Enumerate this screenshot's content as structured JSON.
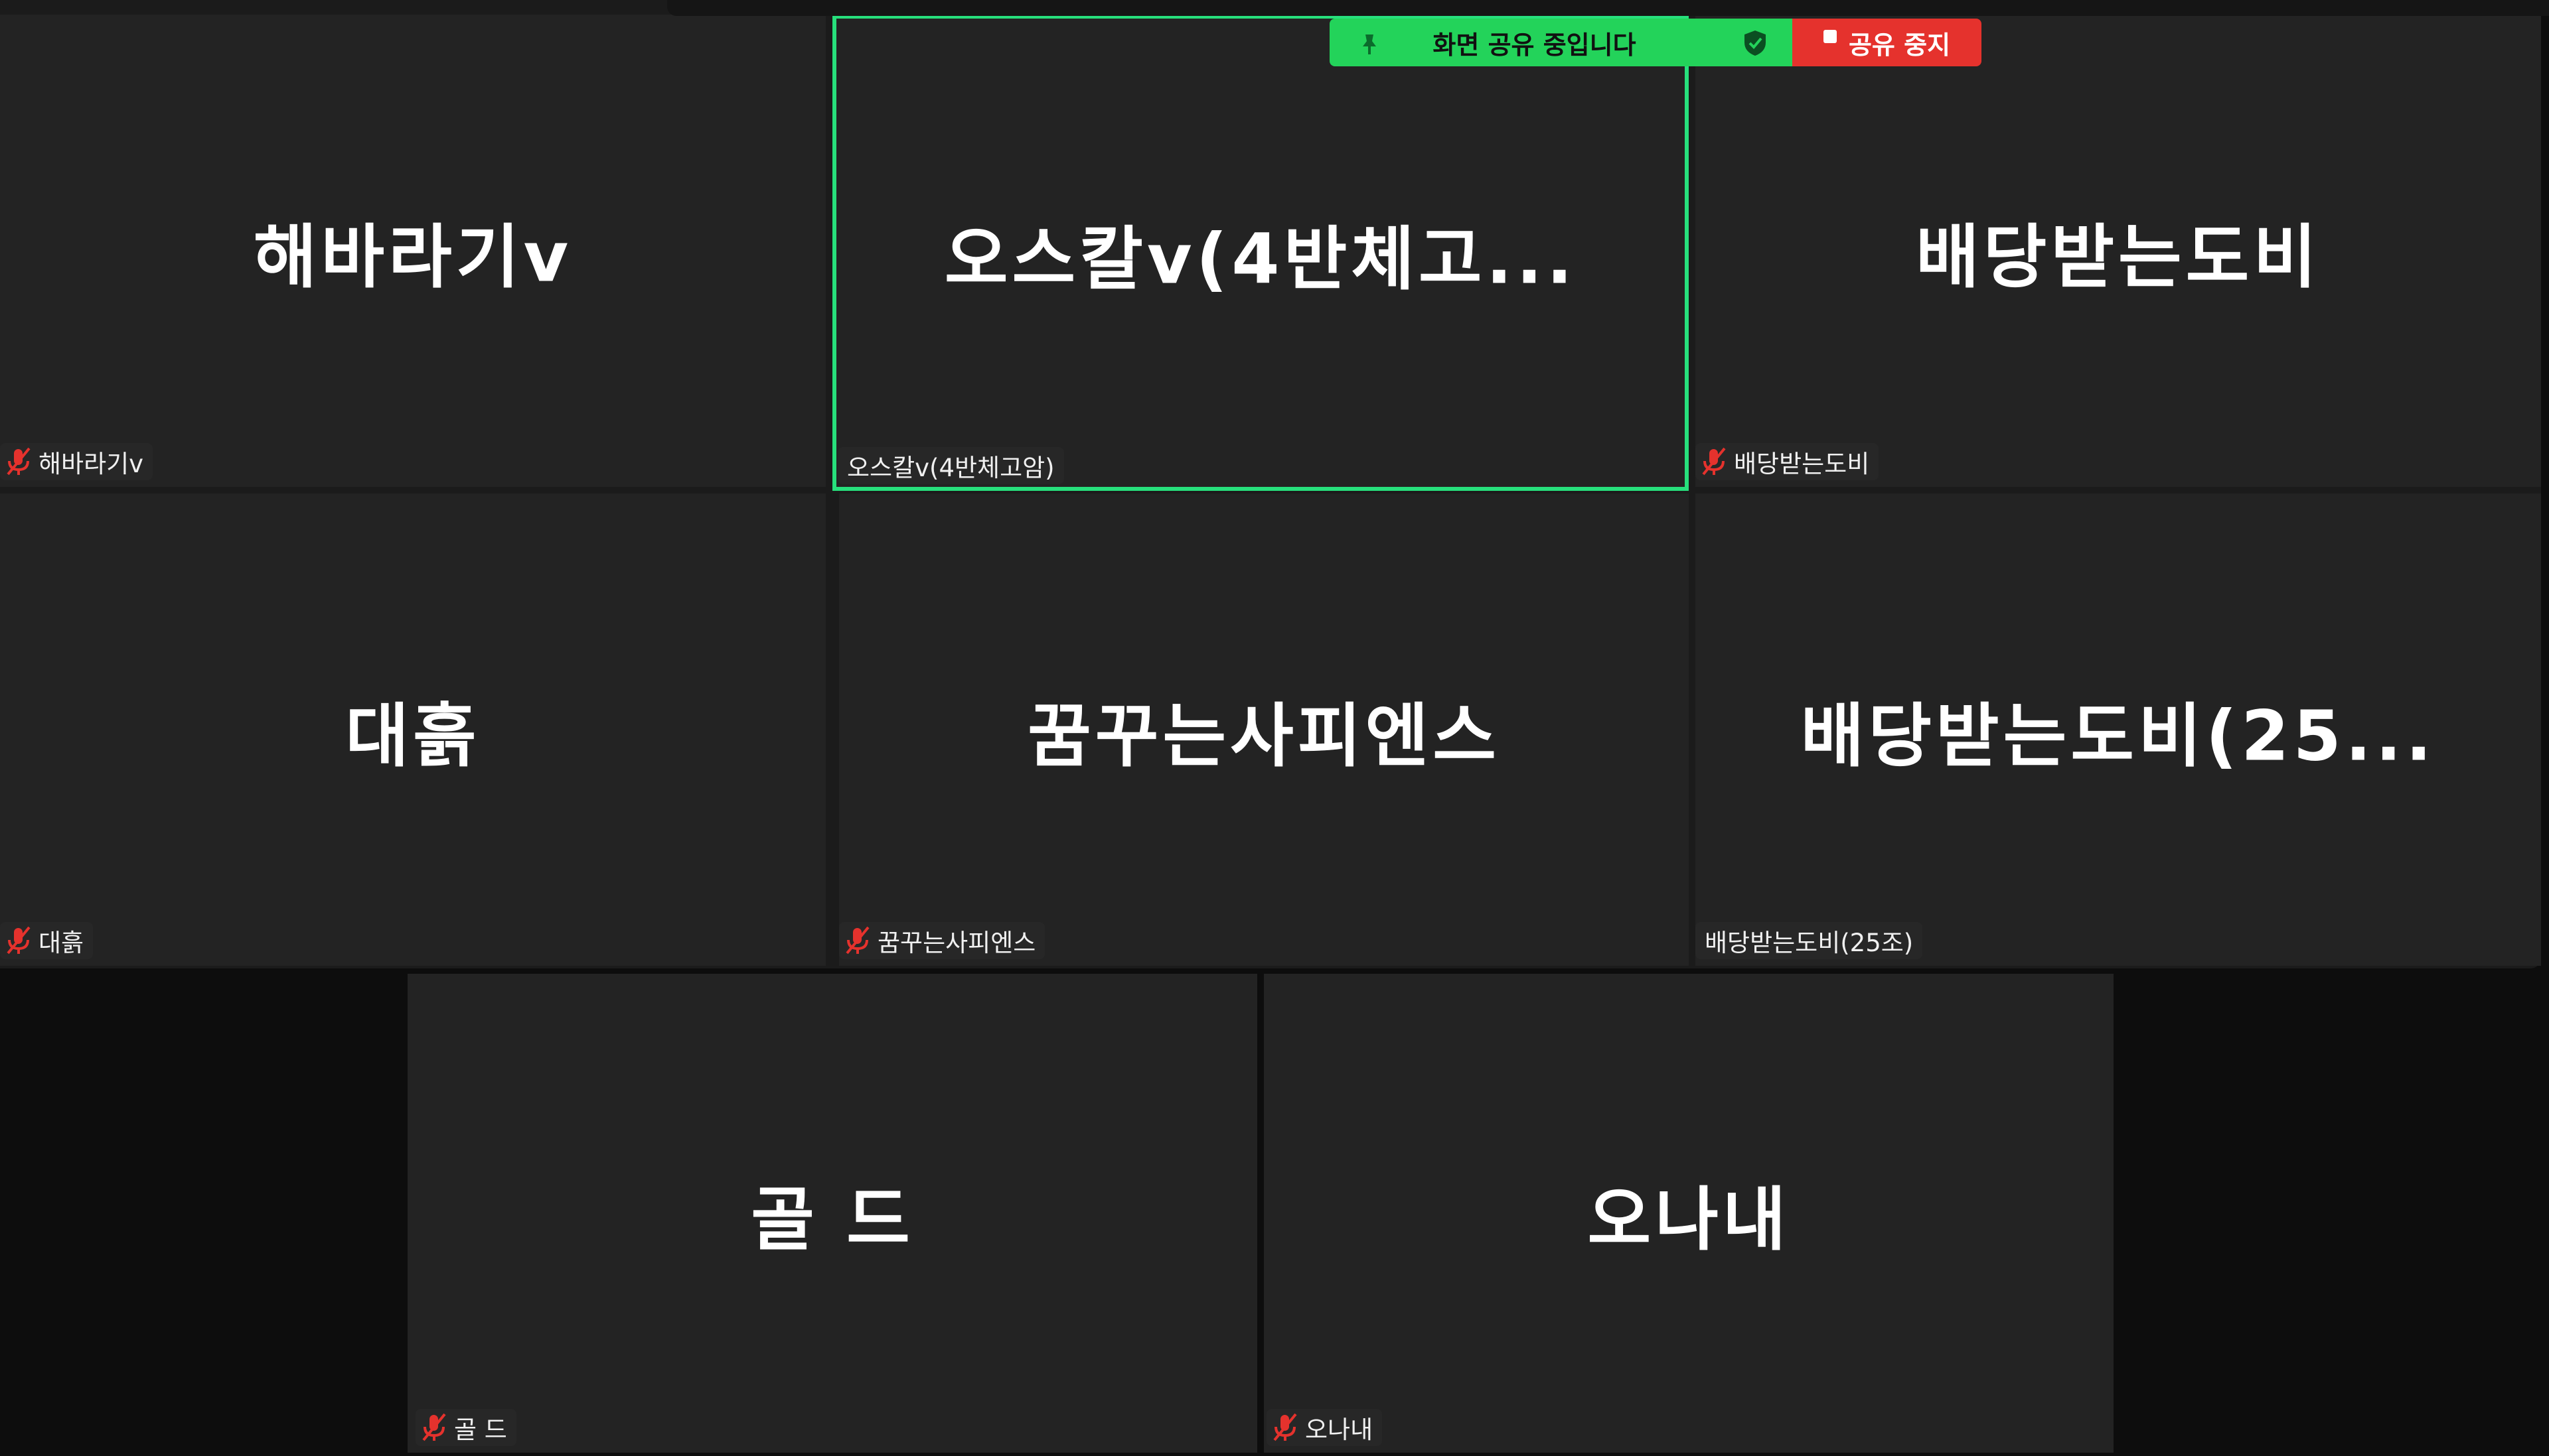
{
  "share_bar": {
    "status": "화면 공유 중입니다",
    "stop_label": "공유 중지"
  },
  "participants": [
    {
      "display": "해바라기v",
      "label": "해바라기v",
      "muted": true
    },
    {
      "display": "오스칼v(4반체고...",
      "label": "오스칼v(4반체고암)",
      "muted": false,
      "active_speaker": true
    },
    {
      "display": "배당받는도비",
      "label": "배당받는도비",
      "muted": true
    },
    {
      "display": "대흙",
      "label": "대흙",
      "muted": true
    },
    {
      "display": "꿈꾸는사피엔스",
      "label": "꿈꾸는사피엔스",
      "muted": true
    },
    {
      "display": "배당받는도비(25...",
      "label": "배당받는도비(25조)",
      "muted": false
    },
    {
      "display": "골 드",
      "label": "골 드",
      "muted": true
    },
    {
      "display": "오나내",
      "label": "오나내",
      "muted": true
    }
  ],
  "colors": {
    "active_border": "#27e07c",
    "share_green": "#23d35a",
    "share_red": "#e5322d",
    "muted_icon": "#e5322d"
  },
  "icons": {
    "muted": "mic-muted-icon",
    "pin": "pin-icon",
    "shield": "shield-check-icon",
    "stop": "stop-square-icon"
  }
}
